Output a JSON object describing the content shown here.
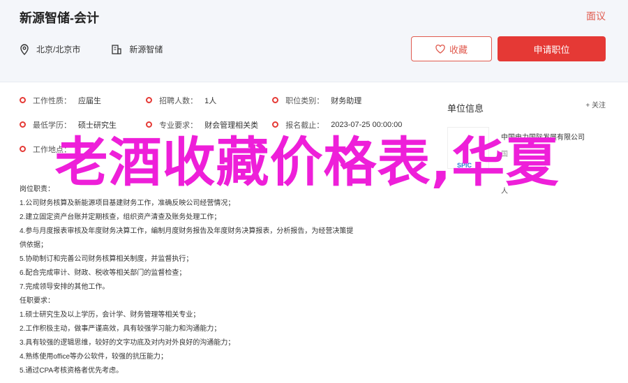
{
  "header": {
    "job_title": "新源智储-会计",
    "report": "面议",
    "location": "北京/北京市",
    "company": "新源智储",
    "favorite_label": "收藏",
    "apply_label": "申请职位"
  },
  "attributes": [
    [
      {
        "key": "工作性质：",
        "value": "应届生"
      },
      {
        "key": "招聘人数：",
        "value": "1人"
      },
      {
        "key": "职位类别：",
        "value": "财务助理"
      }
    ],
    [
      {
        "key": "最低学历：",
        "value": "硕士研究生"
      },
      {
        "key": "专业要求：",
        "value": "财会管理相关类"
      },
      {
        "key": "报名截止：",
        "value": "2023-07-25 00:00:00"
      }
    ],
    [
      {
        "key": "工作地点：",
        "value": ""
      },
      {
        "key": "",
        "value": ""
      },
      {
        "key": "",
        "value": ""
      }
    ]
  ],
  "description": [
    "岗位职责：",
    "1.公司财务核算及新能源项目基建财务工作，准确反映公司经营情况；",
    "2.建立固定资产台账并定期核查，组织资产清查及账务处理工作；",
    "4.参与月度报表审核及年度财务决算工作，编制月度财务报告及年度财务决算报表，分析报告，为经营决策提",
    "供依据；",
    "5.协助制订和完善公司财务核算相关制度，并监督执行；",
    "6.配合完成审计、财政、税收等相关部门的监督检查；",
    "7.完成领导安排的其他工作。",
    "任职要求：",
    "1.硕士研究生及以上学历，会计学、财务管理等相关专业；",
    "2.工作积极主动，做事严谨高效，具有较强学习能力和沟通能力；",
    "3.具有较强的逻辑思维，较好的文字功底及对内对外良好的沟通能力；",
    "4.熟练使用office等办公软件，较强的抗压能力；",
    "5.通过CPA考核资格者优先考虑。"
  ],
  "sidebar": {
    "title": "单位信息",
    "follow": "+ 关注",
    "company_name": "中国电力国际发展有限公司",
    "line2": "国",
    "logo_tag": "SPIC",
    "stat": "人"
  },
  "overlay_text": "老酒收藏价格表,华夏",
  "colors": {
    "accent": "#e53935",
    "overlay": "#ee1fd9"
  }
}
